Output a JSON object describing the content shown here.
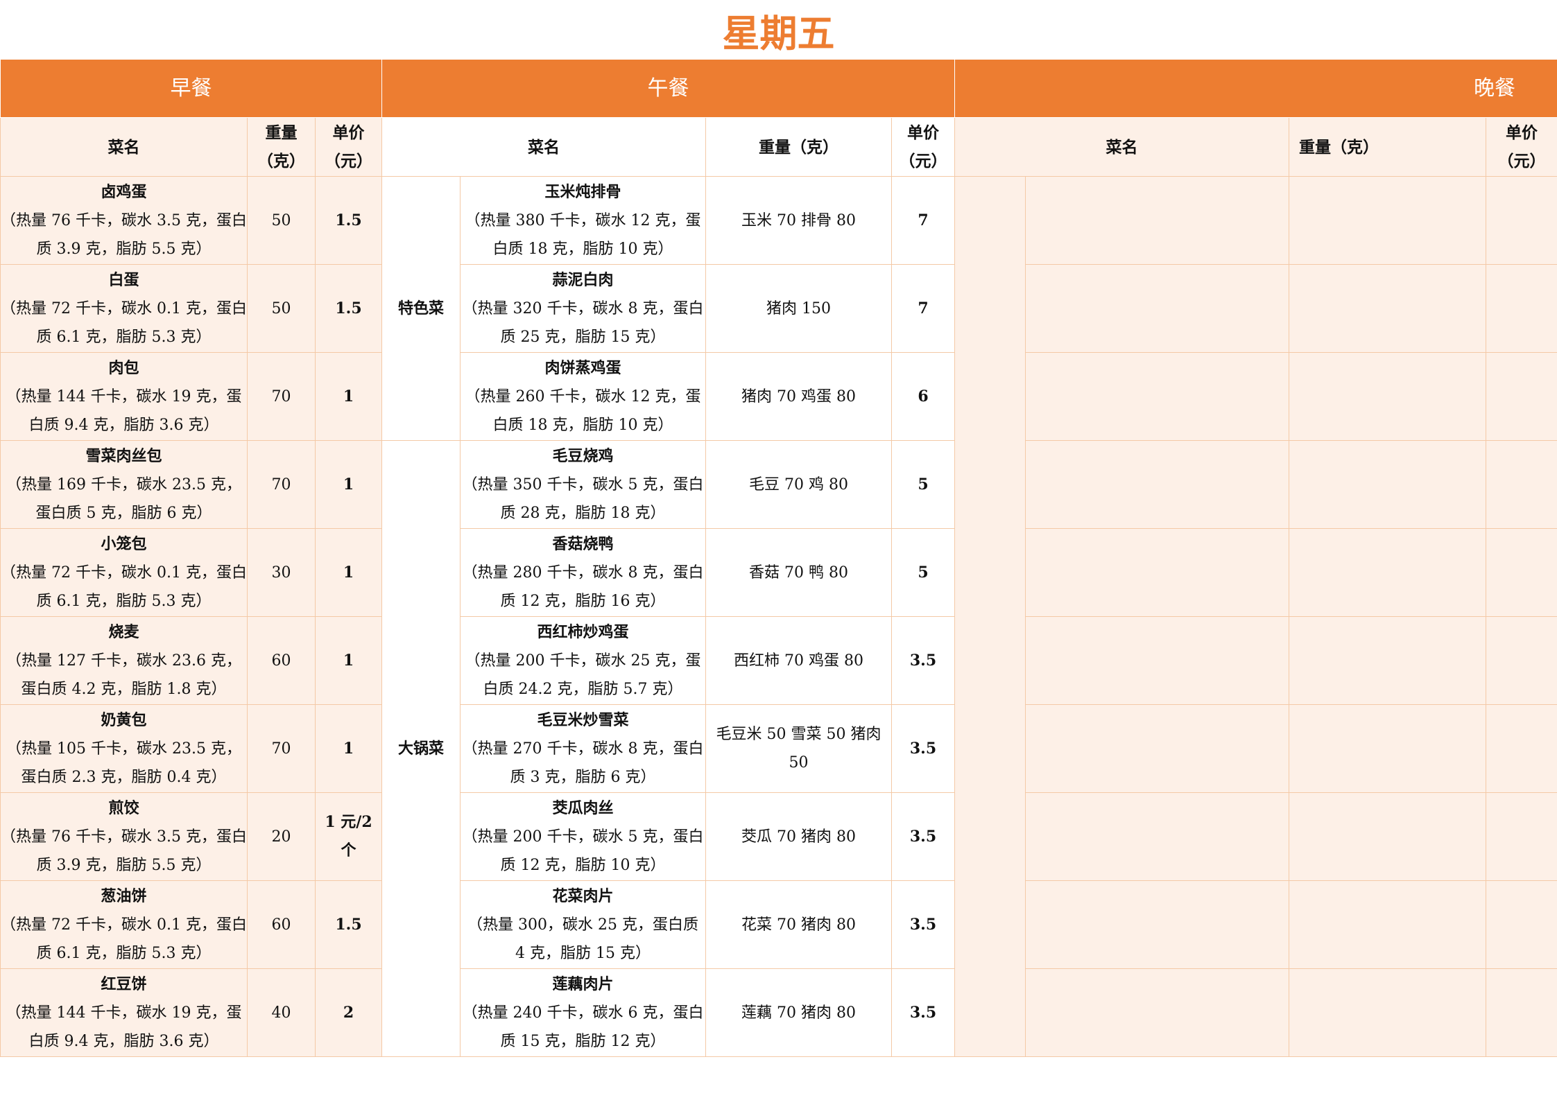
{
  "title": "星期五",
  "meals": {
    "breakfast": "早餐",
    "lunch": "午餐",
    "dinner": "晚餐"
  },
  "headers": {
    "breakfast": {
      "name": "菜名",
      "weight": "重量（克）",
      "price": "单价（元）"
    },
    "lunch": {
      "name": "菜名",
      "weight": "重量（克）",
      "price": "单价（元）"
    },
    "dinner": {
      "name": "菜名",
      "weight": "重量（克）",
      "price": "单价（元）"
    }
  },
  "breakfast": [
    {
      "name": "卤鸡蛋",
      "nutrition": "（热量 76 千卡，碳水 3.5 克，蛋白质 3.9 克，脂肪 5.5 克）",
      "weight": "50",
      "price": "1.5"
    },
    {
      "name": "白蛋",
      "nutrition": "（热量 72 千卡，碳水 0.1 克，蛋白质 6.1 克，脂肪 5.3 克）",
      "weight": "50",
      "price": "1.5"
    },
    {
      "name": "肉包",
      "nutrition": "（热量 144 千卡，碳水 19 克，蛋白质 9.4 克，脂肪 3.6 克）",
      "weight": "70",
      "price": "1"
    },
    {
      "name": "雪菜肉丝包",
      "nutrition": "（热量 169 千卡，碳水 23.5 克，蛋白质 5 克，脂肪 6 克）",
      "weight": "70",
      "price": "1"
    },
    {
      "name": "小笼包",
      "nutrition": "（热量 72 千卡，碳水 0.1 克，蛋白质 6.1 克，脂肪 5.3 克）",
      "weight": "30",
      "price": "1"
    },
    {
      "name": "烧麦",
      "nutrition": "（热量 127 千卡，碳水 23.6 克，蛋白质 4.2 克，脂肪 1.8 克）",
      "weight": "60",
      "price": "1"
    },
    {
      "name": "奶黄包",
      "nutrition": "（热量 105 千卡，碳水 23.5 克，蛋白质 2.3 克，脂肪 0.4 克）",
      "weight": "70",
      "price": "1"
    },
    {
      "name": "煎饺",
      "nutrition": "（热量 76 千卡，碳水 3.5 克，蛋白质 3.9 克，脂肪 5.5 克）",
      "weight": "20",
      "price": "1 元/2 个"
    },
    {
      "name": "葱油饼",
      "nutrition": "（热量 72 千卡，碳水 0.1 克，蛋白质 6.1 克，脂肪 5.3 克）",
      "weight": "60",
      "price": "1.5"
    },
    {
      "name": "红豆饼",
      "nutrition": "（热量 144 千卡，碳水 19 克，蛋白质 9.4 克，脂肪 3.6 克）",
      "weight": "40",
      "price": "2"
    }
  ],
  "lunch_categories": {
    "special": "特色菜",
    "pot": "大锅菜"
  },
  "lunch": [
    {
      "name": "玉米炖排骨",
      "nutrition": "（热量 380 千卡，碳水 12 克，蛋白质 18 克，脂肪 10 克）",
      "weight": "玉米 70 排骨 80",
      "price": "7"
    },
    {
      "name": "蒜泥白肉",
      "nutrition": "（热量 320 千卡，碳水 8 克，蛋白质 25 克，脂肪 15 克）",
      "weight": "猪肉 150",
      "price": "7"
    },
    {
      "name": "肉饼蒸鸡蛋",
      "nutrition": "（热量 260 千卡，碳水 12 克，蛋白质 18 克，脂肪 10 克）",
      "weight": "猪肉 70 鸡蛋 80",
      "price": "6"
    },
    {
      "name": "毛豆烧鸡",
      "nutrition": "（热量 350 千卡，碳水 5 克，蛋白质 28 克，脂肪 18 克）",
      "weight": "毛豆 70 鸡 80",
      "price": "5"
    },
    {
      "name": "香菇烧鸭",
      "nutrition": "（热量 280 千卡，碳水 8 克，蛋白质 12 克，脂肪 16 克）",
      "weight": "香菇 70 鸭 80",
      "price": "5"
    },
    {
      "name": "西红柿炒鸡蛋",
      "nutrition": "（热量 200 千卡，碳水 25 克，蛋白质 24.2 克，脂肪 5.7 克）",
      "weight": "西红柿 70 鸡蛋 80",
      "price": "3.5"
    },
    {
      "name": "毛豆米炒雪菜",
      "nutrition": "（热量 270 千卡，碳水 8 克，蛋白质 3 克，脂肪 6 克）",
      "weight": "毛豆米 50 雪菜 50 猪肉 50",
      "price": "3.5"
    },
    {
      "name": "茭瓜肉丝",
      "nutrition": "（热量 200 千卡，碳水 5 克，蛋白质 12 克，脂肪 10 克）",
      "weight": "茭瓜 70 猪肉 80",
      "price": "3.5"
    },
    {
      "name": "花菜肉片",
      "nutrition": "（热量 300，碳水 25 克，蛋白质 4 克，脂肪 15 克）",
      "weight": "花菜 70 猪肉 80",
      "price": "3.5"
    },
    {
      "name": "莲藕肉片",
      "nutrition": "（热量 240 千卡，碳水 6 克，蛋白质 15 克，脂肪 12 克）",
      "weight": "莲藕 70 猪肉 80",
      "price": "3.5"
    }
  ]
}
